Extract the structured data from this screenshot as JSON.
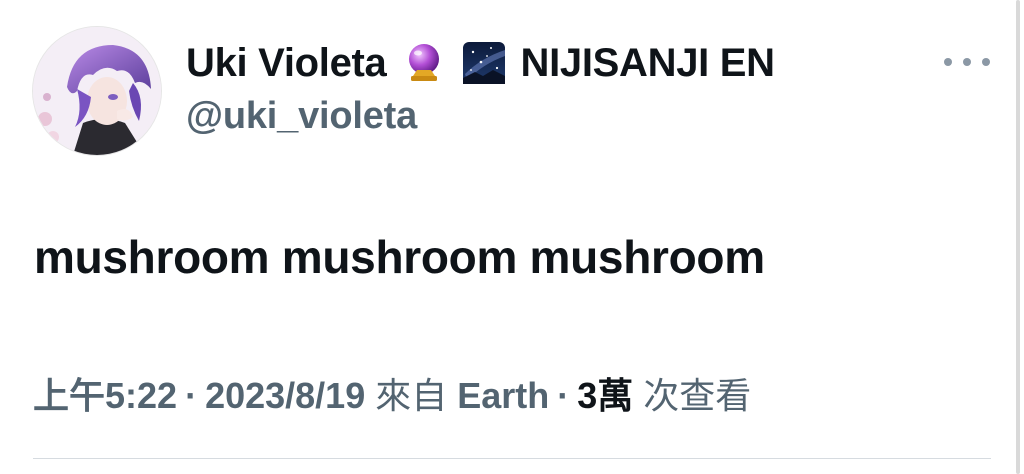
{
  "author": {
    "display_name": "Uki Violeta",
    "emoji_1": "crystal-ball-emoji",
    "emoji_2": "milky-way-emoji",
    "affiliation": "NIJISANJI EN",
    "handle": "@uki_violeta"
  },
  "tweet": {
    "text": "mushroom mushroom mushroom"
  },
  "meta": {
    "time": "上午5:22",
    "separator": "·",
    "date": "2023/8/19",
    "source_prefix": "來自",
    "source": "Earth",
    "views_count": "3萬",
    "views_label": "次查看"
  },
  "colors": {
    "text_primary": "#0f1419",
    "text_secondary": "#536471",
    "divider": "#d6dbe0"
  }
}
